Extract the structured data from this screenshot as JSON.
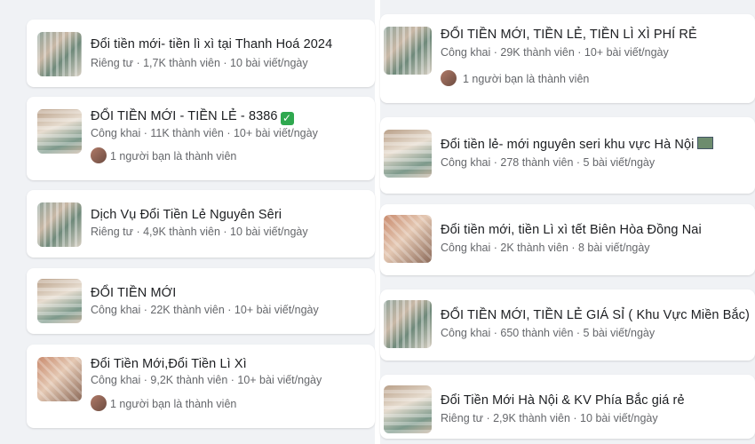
{
  "left_groups": [
    {
      "title": "Đổi tiền mới- tiền lì xì tại Thanh Hoá 2024",
      "meta": "Riêng tư · 1,7K thành viên · 10 bài viết/ngày"
    },
    {
      "title": "ĐỔI TIỀN MỚI - TIỀN LẺ - 8386",
      "meta": "Công khai · 11K thành viên · 10+ bài viết/ngày",
      "friend": "1 người bạn là thành viên",
      "icon": "check-mark-icon"
    },
    {
      "title": "Dịch Vụ Đổi Tiền Lẻ Nguyên Sêri",
      "meta": "Riêng tư · 4,9K thành viên · 10 bài viết/ngày"
    },
    {
      "title": "ĐỔI TIỀN MỚI",
      "meta": "Công khai · 22K thành viên · 10+ bài viết/ngày"
    },
    {
      "title": "Đổi Tiền Mới,Đổi Tiền Lì Xì",
      "meta": "Công khai · 9,2K thành viên · 10+ bài viết/ngày",
      "friend": "1 người bạn là thành viên"
    }
  ],
  "right_groups": [
    {
      "title": "ĐỔI TIỀN MỚI, TIỀN LẺ, TIỀN LÌ XÌ PHÍ RẺ",
      "meta": "Công khai · 29K thành viên · 10+ bài viết/ngày",
      "friend": "1 người bạn là thành viên"
    },
    {
      "title": "Đổi tiền lẻ- mới nguyên seri khu vực Hà Nội",
      "meta": "Công khai · 278 thành viên · 5 bài viết/ngày",
      "icon": "money-flag-icon"
    },
    {
      "title": "Đổi tiền mới, tiền Lì xì tết Biên Hòa Đồng Nai",
      "meta": "Công khai · 2K thành viên · 8 bài viết/ngày"
    },
    {
      "title": "ĐỔI TIỀN MỚI, TIỀN LẺ GIÁ SỈ ( Khu Vực Miền Bắc)",
      "meta": "Công khai · 650 thành viên · 5 bài viết/ngày"
    },
    {
      "title": "Đổi Tiền Mới Hà Nội & KV Phía Bắc giá rẻ",
      "meta": "Riêng tư · 2,9K thành viên · 10 bài viết/ngày"
    }
  ]
}
